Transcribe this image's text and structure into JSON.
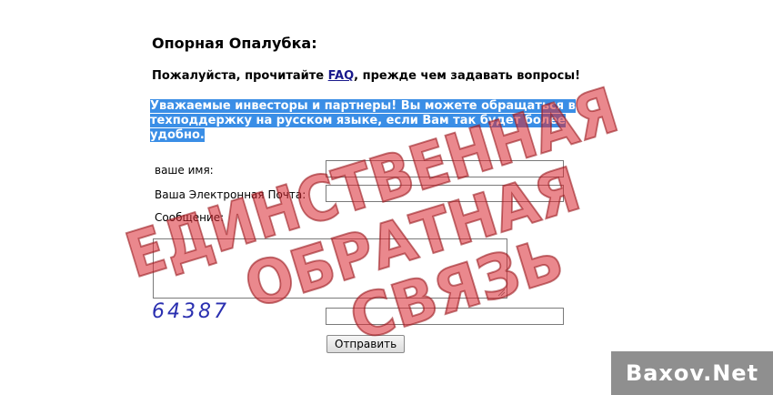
{
  "page": {
    "title": "Опорная Опалубка:",
    "notice_before": "Пожалуйста, прочитайте ",
    "faq_link": "FAQ",
    "notice_after": ", прежде чем задавать вопросы!",
    "highlight_text": "Уважаемые инвесторы и партнеры! Вы можете обращаться в техподдержку на русском языке, если Вам так будет более удобно."
  },
  "form": {
    "name_label": "ваше имя:",
    "name_value": "",
    "email_label": "Ваша Электронная Почта:",
    "email_value": "",
    "message_label": "Сообщение:",
    "message_value": "",
    "captcha_text": "64387",
    "captcha_value": "",
    "submit_label": "Отправить"
  },
  "stamp": {
    "line1": "ЕДИНСТВЕННАЯ",
    "line2": "ОБРАТНАЯ",
    "line3": "СВЯЗЬ",
    "color": "#d9262f"
  },
  "watermark": {
    "text": "Baxov.Net"
  },
  "colors": {
    "highlight_bg": "#3a8ee6",
    "link": "#1a1a8c",
    "captcha": "#2a2fb0"
  }
}
